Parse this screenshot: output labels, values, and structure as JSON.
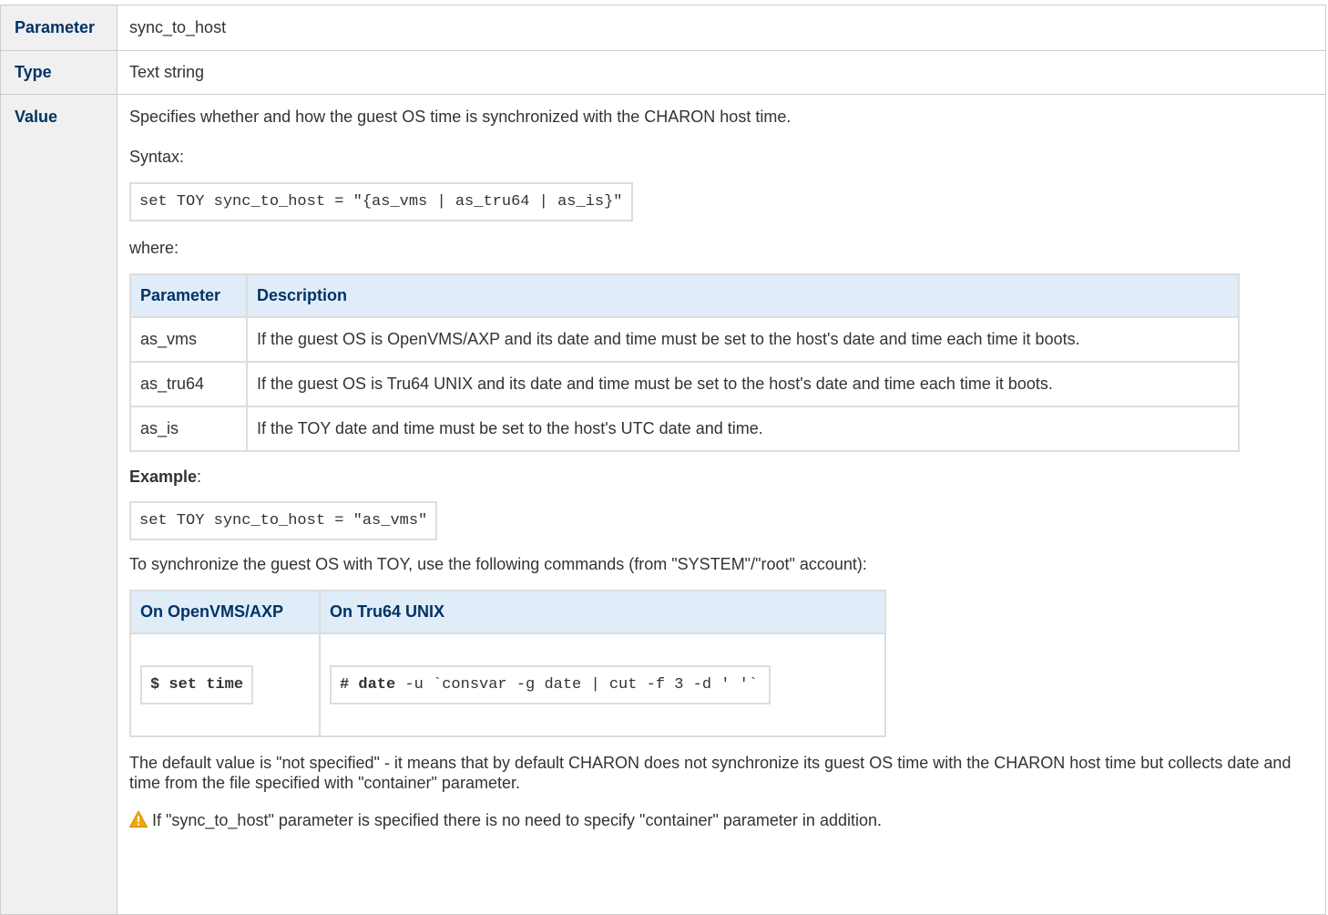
{
  "rows": {
    "parameter": {
      "label": "Parameter",
      "value": "sync_to_host"
    },
    "type": {
      "label": "Type",
      "value": "Text string"
    },
    "value": {
      "label": "Value"
    }
  },
  "value": {
    "intro": "Specifies whether and how the guest OS time is synchronized with the CHARON host time.",
    "syntax_label": "Syntax:",
    "syntax_code": "set TOY sync_to_host = \"{as_vms | as_tru64 | as_is}\"",
    "where_label": "where:",
    "param_table": {
      "headers": [
        "Parameter",
        "Description"
      ],
      "rows": [
        {
          "param": "as_vms",
          "desc": "If the guest OS is OpenVMS/AXP and its date and time must be set to the host's date and time each time it boots."
        },
        {
          "param": "as_tru64",
          "desc": "If the guest OS is Tru64 UNIX and its date and time must be set to the host's date and time each time it boots."
        },
        {
          "param": "as_is",
          "desc": "If the TOY date and time must be set to the host's UTC date and time."
        }
      ]
    },
    "example_label": "Example",
    "example_colon": ":",
    "example_code": "set TOY sync_to_host = \"as_vms\"",
    "sync_text": "To synchronize the guest OS with TOY, use the following commands (from \"SYSTEM\"/\"root\" account):",
    "cmd_table": {
      "headers": [
        "On OpenVMS/AXP",
        "On Tru64 UNIX"
      ],
      "vms_cmd": "$ set time",
      "tru64_prompt": "# date",
      "tru64_rest": " -u `consvar -g date | cut -f 3 -d ' '`"
    },
    "default_text": "The default value is \"not specified\" - it means that by default CHARON does not synchronize its guest OS time with the CHARON host time but collects date and time from the file specified with \"container\" parameter.",
    "warning_text": "If \"sync_to_host\" parameter is specified there is no need to specify \"container\" parameter in addition.",
    "warning_icon": "warning-icon",
    "warning_color": "#f0a800"
  }
}
